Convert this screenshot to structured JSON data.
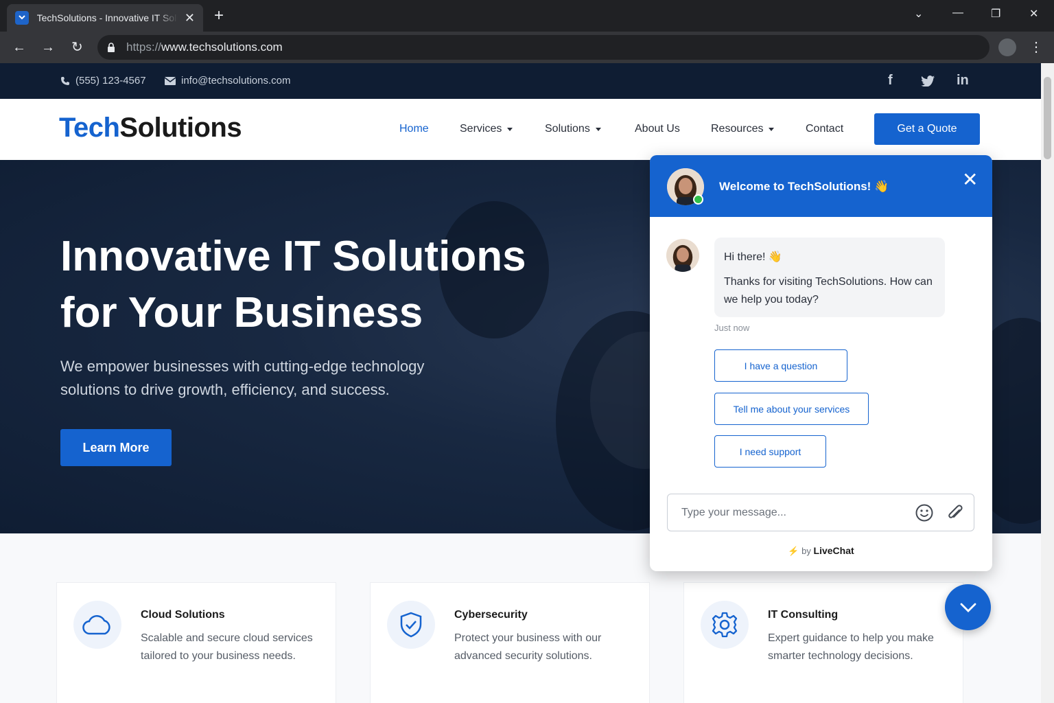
{
  "browser": {
    "tab_title": "TechSolutions - Innovative IT Solutions",
    "url_scheme": "https://",
    "url_host": "www.techsolutions.com"
  },
  "topbar": {
    "phone": "(555) 123-4567",
    "email": "info@techsolutions.com",
    "social": [
      "f",
      "twitter",
      "in"
    ]
  },
  "header": {
    "logo_accent": "Tech",
    "logo_rest": "Solutions",
    "nav": [
      "Home",
      "Services",
      "Solutions",
      "About Us",
      "Resources",
      "Contact"
    ],
    "active_nav": "Home",
    "quote_button": "Get a Quote"
  },
  "hero": {
    "title_line1": "Innovative IT Solutions",
    "title_line2": "for Your Business",
    "subtitle": "We empower businesses with cutting-edge technology solutions to drive growth, efficiency, and success.",
    "cta": "Learn More"
  },
  "features": [
    {
      "title": "Cloud Solutions",
      "desc": "Scalable and secure cloud services tailored to your business needs.",
      "icon": "cloud-icon"
    },
    {
      "title": "Cybersecurity",
      "desc": "Protect your business with our advanced security solutions.",
      "icon": "shield-icon"
    },
    {
      "title": "IT Consulting",
      "desc": "Expert guidance to help you make smarter technology decisions.",
      "icon": "gear-icon"
    }
  ],
  "chat": {
    "title": "Welcome to TechSolutions! 👋",
    "greeting": "Hi there! 👋",
    "message": "Thanks for visiting TechSolutions. How can we help you today?",
    "time": "Just now",
    "quick_replies": [
      "I have a question",
      "Tell me about your services",
      "I need support"
    ],
    "input_placeholder": "Type your message...",
    "powered_prefix": "by",
    "powered_brand": "LiveChat"
  },
  "colors": {
    "brand": "#1563cf",
    "navy": "#0f1d33",
    "online": "#2fbf4a"
  }
}
